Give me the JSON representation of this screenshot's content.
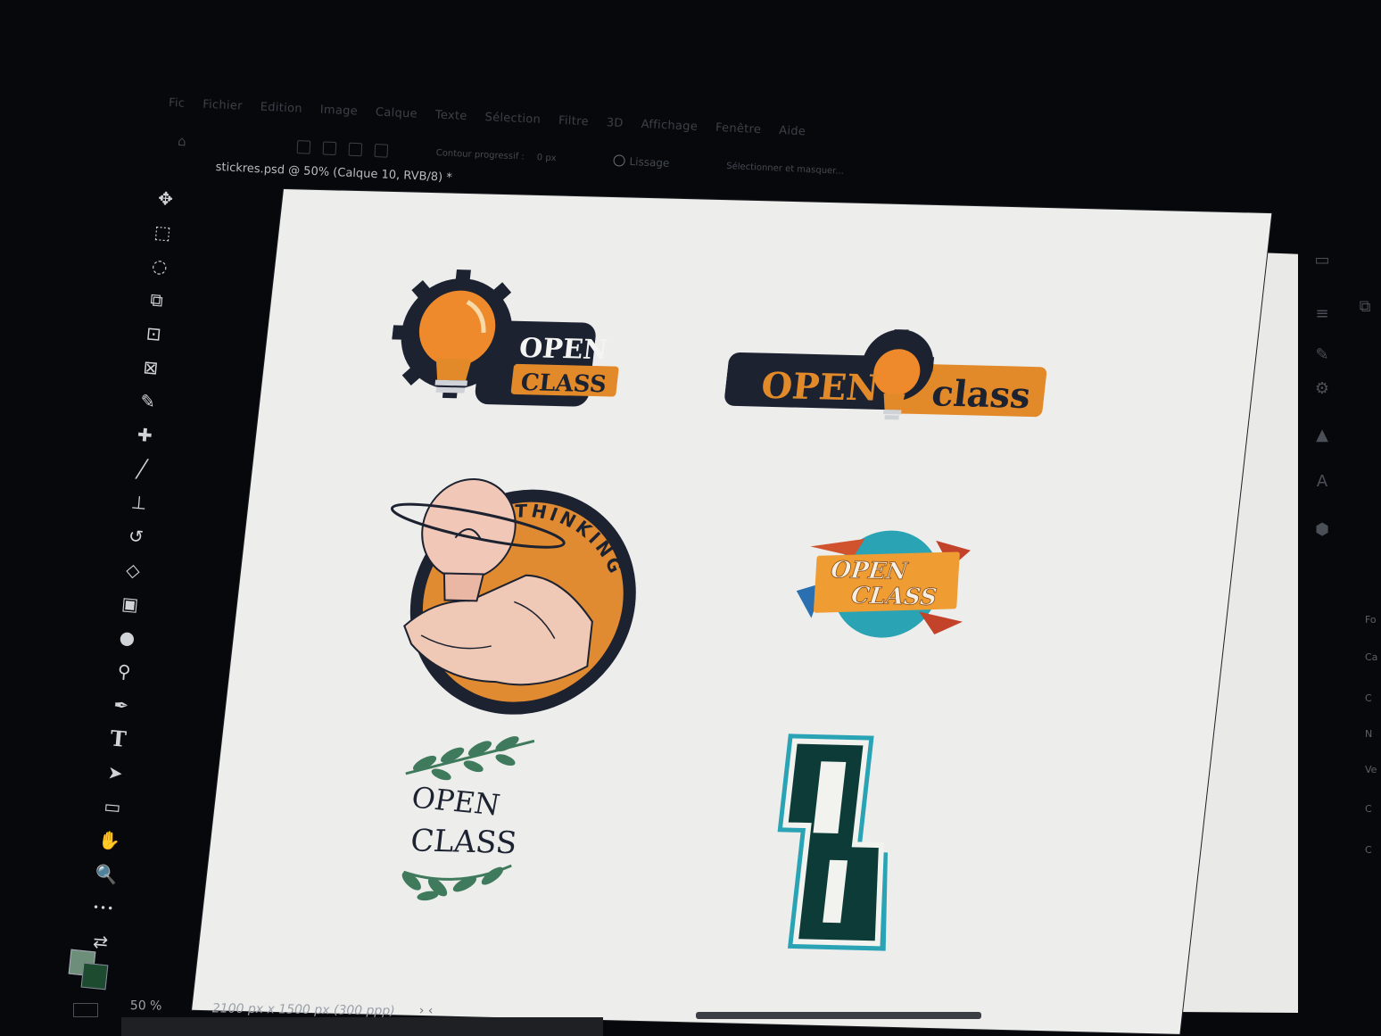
{
  "menu": {
    "items": [
      "Fic",
      "Fichier",
      "Edition",
      "Image",
      "Calque",
      "Texte",
      "Sélection",
      "Filtre",
      "3D",
      "Affichage",
      "Fenêtre",
      "Aide"
    ]
  },
  "options_bar": {
    "contour_label": "Contour progressif :",
    "contour_value": "0 px",
    "lissage_label": "Lissage",
    "select_mask_label": "Sélectionner et masquer..."
  },
  "document": {
    "tab_title": "stickres.psd @ 50% (Calque 10, RVB/8) *"
  },
  "toolbar": {
    "tools": [
      {
        "icon": "move-tool-icon",
        "glyph": "✥"
      },
      {
        "icon": "marquee-tool-icon",
        "glyph": "⬚"
      },
      {
        "icon": "lasso-tool-icon",
        "glyph": "◌"
      },
      {
        "icon": "object-select-tool-icon",
        "glyph": "⧉"
      },
      {
        "icon": "crop-tool-icon",
        "glyph": "⊡"
      },
      {
        "icon": "frame-tool-icon",
        "glyph": "⊠"
      },
      {
        "icon": "eyedropper-tool-icon",
        "glyph": "✎"
      },
      {
        "icon": "healing-brush-icon",
        "glyph": "✚"
      },
      {
        "icon": "brush-tool-icon",
        "glyph": "╱"
      },
      {
        "icon": "stamp-tool-icon",
        "glyph": "⊥"
      },
      {
        "icon": "history-brush-icon",
        "glyph": "↺"
      },
      {
        "icon": "eraser-tool-icon",
        "glyph": "◇"
      },
      {
        "icon": "gradient-tool-icon",
        "glyph": "▣"
      },
      {
        "icon": "blur-tool-icon",
        "glyph": "●"
      },
      {
        "icon": "dodge-tool-icon",
        "glyph": "⚲"
      },
      {
        "icon": "pen-tool-icon",
        "glyph": "✒"
      },
      {
        "icon": "type-tool-icon",
        "glyph": "T"
      },
      {
        "icon": "path-select-tool-icon",
        "glyph": "➤"
      },
      {
        "icon": "rectangle-tool-icon",
        "glyph": "▭"
      },
      {
        "icon": "hand-tool-icon",
        "glyph": "✋"
      },
      {
        "icon": "zoom-tool-icon",
        "glyph": "🔍"
      },
      {
        "icon": "more-tools-icon",
        "glyph": "•••"
      },
      {
        "icon": "swap-colors-icon",
        "glyph": "⇄"
      }
    ],
    "foreground_color": "#6d8e78",
    "background_color": "#1c4b2f"
  },
  "stickers": {
    "s1": {
      "line1": "OPEN",
      "line2": "CLASS"
    },
    "s2": {
      "word1": "OPEN",
      "word2": "class"
    },
    "s3": {
      "text": "THINKING"
    },
    "s4": {
      "line1": "OPEN",
      "line2": "CLASS"
    },
    "s5": {
      "line1": "OPEN",
      "line2": "CLASS"
    },
    "s6": {
      "monogram": "OC"
    }
  },
  "status_bar": {
    "zoom": "50 %",
    "dimensions": "2100 px x 1500 px (300 ppp)",
    "nav": "›  ‹"
  },
  "right_edge": {
    "labels": [
      "Fo",
      "Ca",
      "C",
      "N",
      "Ve",
      "C",
      "C"
    ]
  },
  "colors": {
    "accent_orange": "#e28a2a",
    "dark_navy": "#1c2230",
    "leaf_green": "#3f7a5c",
    "teal": "#2aa3b5",
    "canvas": "#ededec"
  }
}
